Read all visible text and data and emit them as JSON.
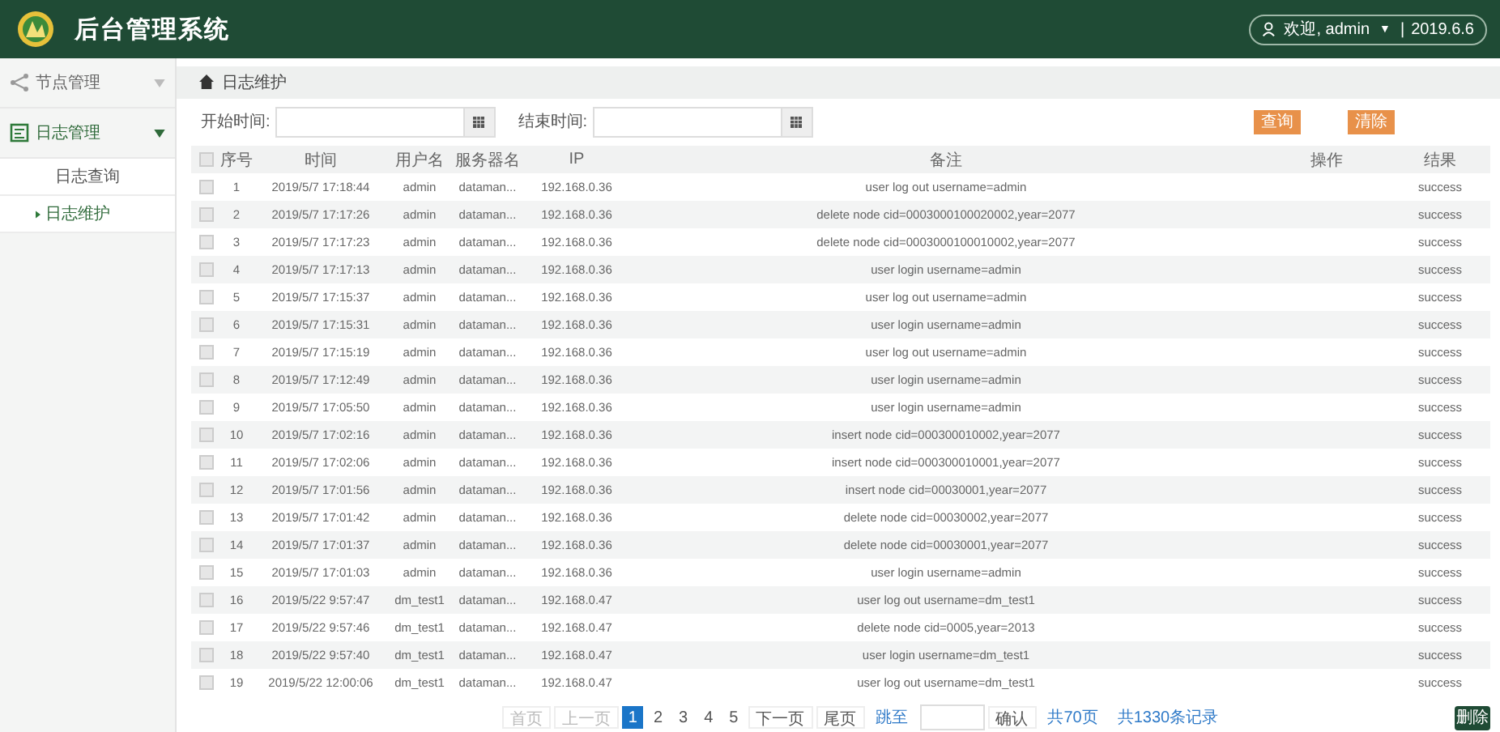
{
  "header": {
    "title": "后台管理系统",
    "welcome": "欢迎, admin",
    "caret": "▼",
    "separator": "|",
    "date": "2019.6.6"
  },
  "sidebar": {
    "items": [
      {
        "label": "节点管理",
        "expanded": false
      },
      {
        "label": "日志管理",
        "expanded": true,
        "children": [
          {
            "label": "日志查询",
            "selected": false
          },
          {
            "label": "日志维护",
            "selected": true
          }
        ]
      }
    ]
  },
  "breadcrumb": "日志维护",
  "filters": {
    "start_label": "开始时间:",
    "end_label": "结束时间:",
    "query_button": "查询",
    "clear_button": "清除"
  },
  "table": {
    "all_checked": false,
    "columns": [
      "序号",
      "时间",
      "用户名",
      "服务器名",
      "IP",
      "备注",
      "操作",
      "结果"
    ],
    "rows": [
      {
        "checked": false,
        "cells": [
          "1",
          "2019/5/7 17:18:44",
          "admin",
          "dataman...",
          "192.168.0.36",
          "user log out username=admin",
          "",
          "success"
        ]
      },
      {
        "checked": false,
        "cells": [
          "2",
          "2019/5/7 17:17:26",
          "admin",
          "dataman...",
          "192.168.0.36",
          "delete node cid=0003000100020002,year=2077",
          "",
          "success"
        ]
      },
      {
        "checked": false,
        "cells": [
          "3",
          "2019/5/7 17:17:23",
          "admin",
          "dataman...",
          "192.168.0.36",
          "delete node cid=0003000100010002,year=2077",
          "",
          "success"
        ]
      },
      {
        "checked": false,
        "cells": [
          "4",
          "2019/5/7 17:17:13",
          "admin",
          "dataman...",
          "192.168.0.36",
          "user login username=admin",
          "",
          "success"
        ]
      },
      {
        "checked": false,
        "cells": [
          "5",
          "2019/5/7 17:15:37",
          "admin",
          "dataman...",
          "192.168.0.36",
          "user log out username=admin",
          "",
          "success"
        ]
      },
      {
        "checked": false,
        "cells": [
          "6",
          "2019/5/7 17:15:31",
          "admin",
          "dataman...",
          "192.168.0.36",
          "user login username=admin",
          "",
          "success"
        ]
      },
      {
        "checked": false,
        "cells": [
          "7",
          "2019/5/7 17:15:19",
          "admin",
          "dataman...",
          "192.168.0.36",
          "user log out username=admin",
          "",
          "success"
        ]
      },
      {
        "checked": false,
        "cells": [
          "8",
          "2019/5/7 17:12:49",
          "admin",
          "dataman...",
          "192.168.0.36",
          "user login username=admin",
          "",
          "success"
        ]
      },
      {
        "checked": false,
        "cells": [
          "9",
          "2019/5/7 17:05:50",
          "admin",
          "dataman...",
          "192.168.0.36",
          "user login username=admin",
          "",
          "success"
        ]
      },
      {
        "checked": false,
        "cells": [
          "10",
          "2019/5/7 17:02:16",
          "admin",
          "dataman...",
          "192.168.0.36",
          "insert node cid=000300010002,year=2077",
          "",
          "success"
        ]
      },
      {
        "checked": false,
        "cells": [
          "11",
          "2019/5/7 17:02:06",
          "admin",
          "dataman...",
          "192.168.0.36",
          "insert node cid=000300010001,year=2077",
          "",
          "success"
        ]
      },
      {
        "checked": false,
        "cells": [
          "12",
          "2019/5/7 17:01:56",
          "admin",
          "dataman...",
          "192.168.0.36",
          "insert node cid=00030001,year=2077",
          "",
          "success"
        ]
      },
      {
        "checked": false,
        "cells": [
          "13",
          "2019/5/7 17:01:42",
          "admin",
          "dataman...",
          "192.168.0.36",
          "delete node cid=00030002,year=2077",
          "",
          "success"
        ]
      },
      {
        "checked": false,
        "cells": [
          "14",
          "2019/5/7 17:01:37",
          "admin",
          "dataman...",
          "192.168.0.36",
          "delete node cid=00030001,year=2077",
          "",
          "success"
        ]
      },
      {
        "checked": false,
        "cells": [
          "15",
          "2019/5/7 17:01:03",
          "admin",
          "dataman...",
          "192.168.0.36",
          "user login username=admin",
          "",
          "success"
        ]
      },
      {
        "checked": false,
        "cells": [
          "16",
          "2019/5/22 9:57:47",
          "dm_test1",
          "dataman...",
          "192.168.0.47",
          "user log out username=dm_test1",
          "",
          "success"
        ]
      },
      {
        "checked": false,
        "cells": [
          "17",
          "2019/5/22 9:57:46",
          "dm_test1",
          "dataman...",
          "192.168.0.47",
          "delete node cid=0005,year=2013",
          "",
          "success"
        ]
      },
      {
        "checked": false,
        "cells": [
          "18",
          "2019/5/22 9:57:40",
          "dm_test1",
          "dataman...",
          "192.168.0.47",
          "user login username=dm_test1",
          "",
          "success"
        ]
      },
      {
        "checked": false,
        "cells": [
          "19",
          "2019/5/22 12:00:06",
          "dm_test1",
          "dataman...",
          "192.168.0.47",
          "user log out username=dm_test1",
          "",
          "success"
        ]
      }
    ]
  },
  "pagination": {
    "pages": [
      {
        "label": "首页",
        "kind": "nav",
        "disabled": true,
        "selected": false
      },
      {
        "label": "上一页",
        "kind": "nav",
        "disabled": true,
        "selected": false
      },
      {
        "label": "1",
        "kind": "page",
        "disabled": false,
        "selected": true
      },
      {
        "label": "2",
        "kind": "page",
        "disabled": false,
        "selected": false
      },
      {
        "label": "3",
        "kind": "page",
        "disabled": false,
        "selected": false
      },
      {
        "label": "4",
        "kind": "page",
        "disabled": false,
        "selected": false
      },
      {
        "label": "5",
        "kind": "page",
        "disabled": false,
        "selected": false
      },
      {
        "label": "下一页",
        "kind": "nav",
        "disabled": false,
        "selected": false
      },
      {
        "label": "尾页",
        "kind": "nav",
        "disabled": false,
        "selected": false
      }
    ],
    "jump_label": "跳至",
    "confirm": "确认",
    "total_pages": "共70页",
    "total_records": "共1330条记录"
  },
  "delete_button": "删除"
}
